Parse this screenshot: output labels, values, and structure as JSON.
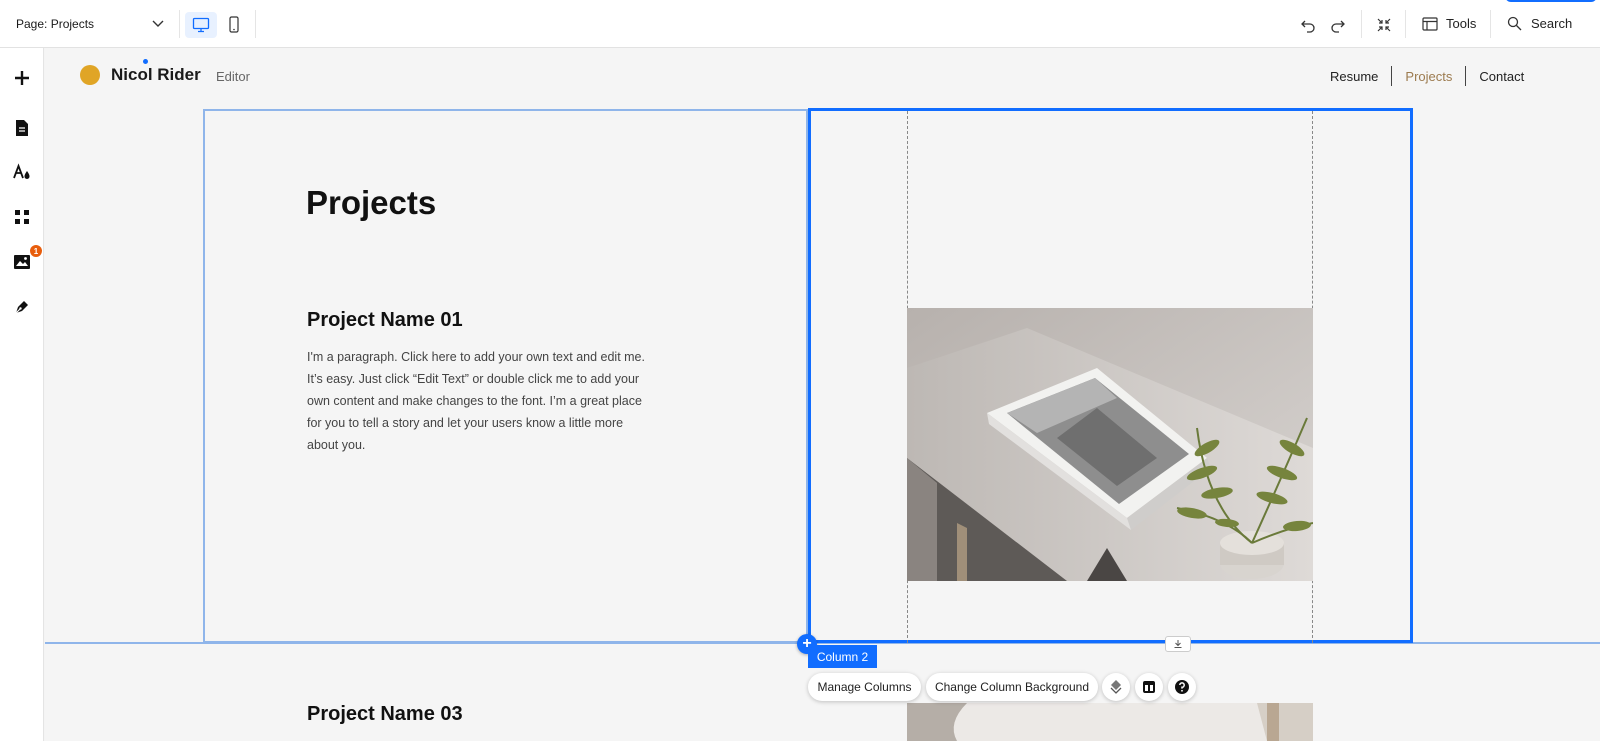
{
  "toolbar": {
    "page_select_label": "Page: Projects",
    "tools_label": "Tools",
    "search_label": "Search",
    "icons": [
      "chevron-down-icon",
      "desktop-icon",
      "mobile-icon",
      "undo-icon",
      "redo-icon",
      "zoom-out-icon",
      "tools-icon",
      "search-icon"
    ]
  },
  "left_rail": {
    "items": [
      "add-icon",
      "pages-icon",
      "theme-icon",
      "apps-icon",
      "media-icon",
      "blog-icon"
    ],
    "apps_badge": "1"
  },
  "site": {
    "name": "Nicol Rider",
    "subtitle": "Editor",
    "nav": [
      "Resume",
      "Projects",
      "Contact"
    ],
    "active_nav": "Projects",
    "logo_color": "#e0a526",
    "accent_color": "#9c7b4f"
  },
  "content": {
    "page_heading": "Projects",
    "project1_title": "Project Name 01",
    "project1_text": "I'm a paragraph. Click here to add your own text and edit me. It’s easy. Just click “Edit Text” or double click me to add your own content and make changes to the font. I’m a great place for you to tell a story and let your users know a little more about you.",
    "project3_title": "Project Name 03"
  },
  "selection": {
    "column_label": "Column 2",
    "manage_columns": "Manage Columns",
    "change_background": "Change Column Background",
    "selection_color": "#116dff"
  }
}
